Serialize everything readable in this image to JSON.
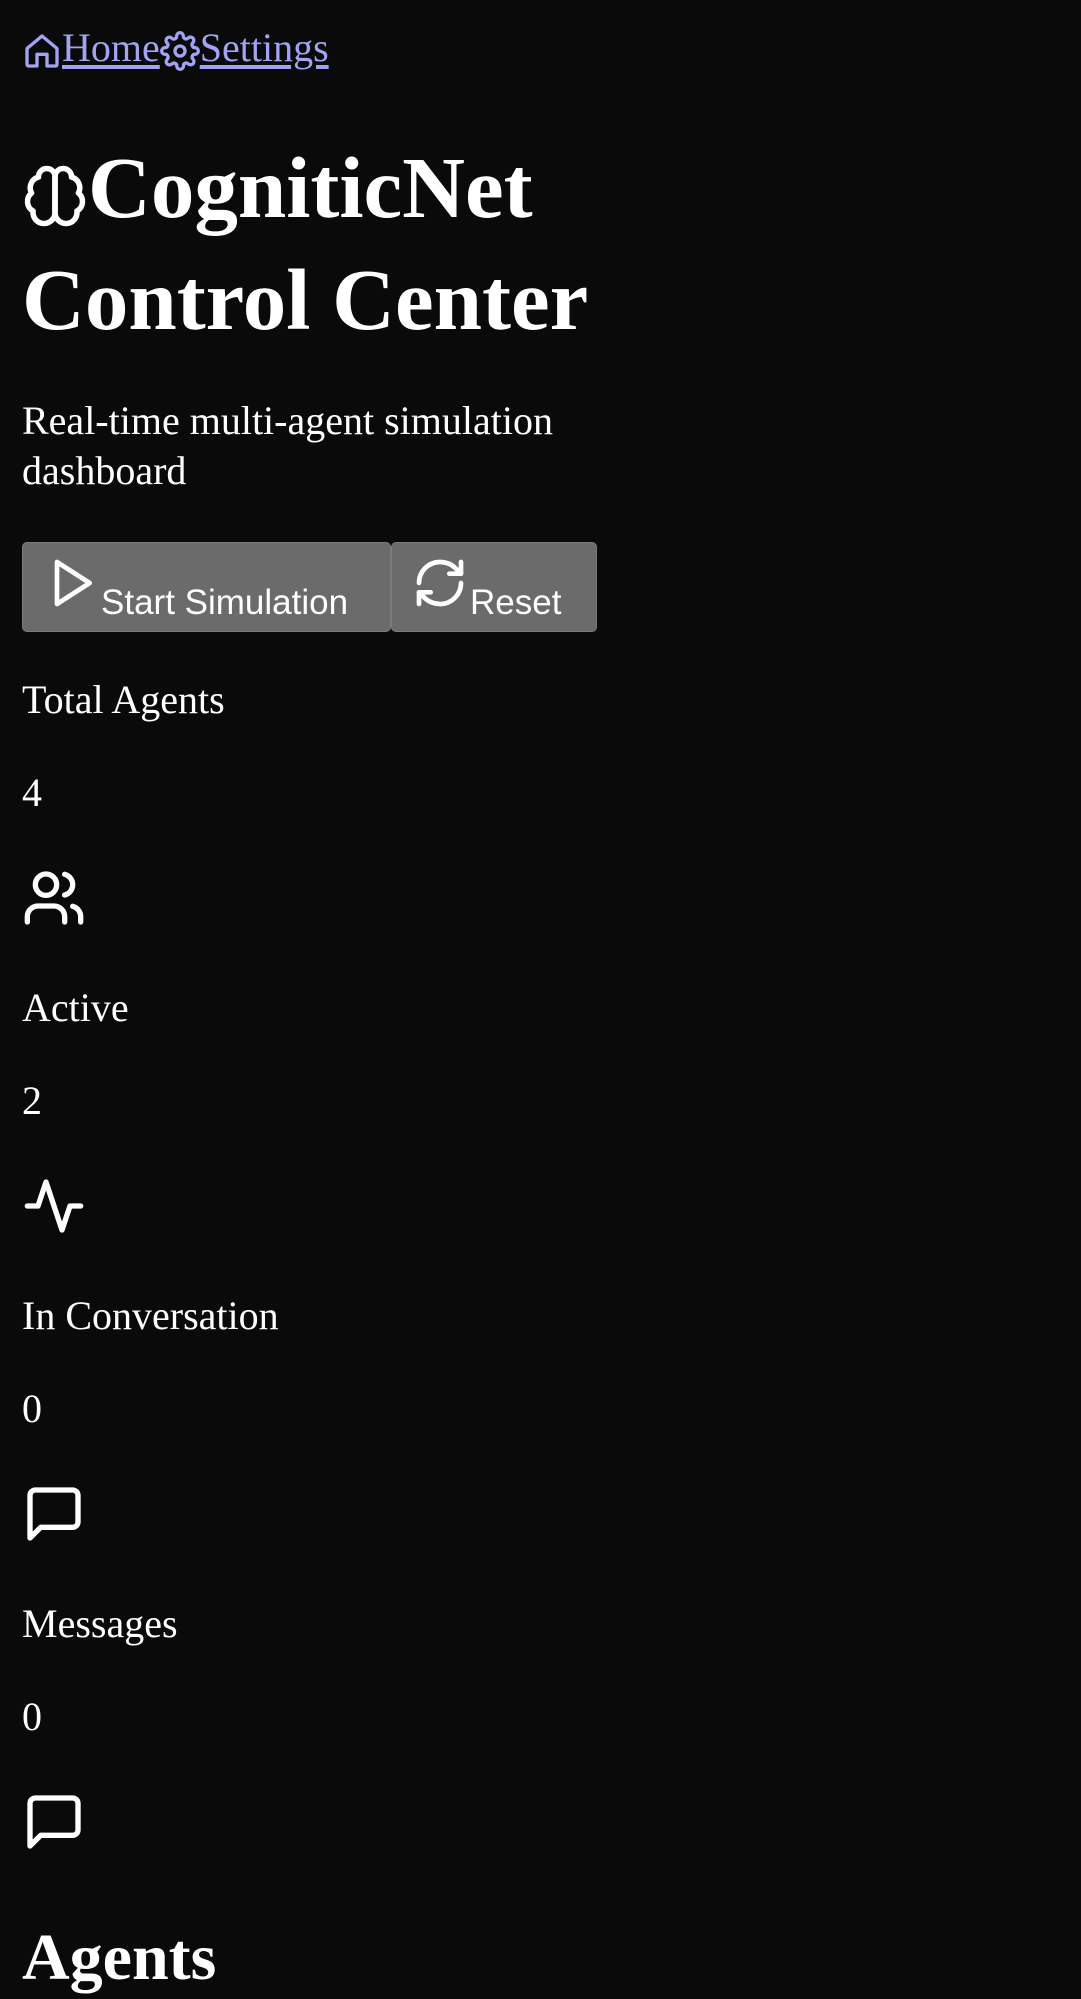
{
  "nav": {
    "home_label": "Home",
    "settings_label": "Settings"
  },
  "header": {
    "title_line1": "CogniticNet",
    "title_line2": "Control Center",
    "subtitle": "Real-time multi-agent simulation dashboard",
    "icon": "brain-icon"
  },
  "actions": {
    "start_label": "Start Simulation",
    "start_icon": "play-icon",
    "reset_label": "Reset",
    "reset_icon": "refresh-icon"
  },
  "stats": [
    {
      "label": "Total Agents",
      "value": "4",
      "icon": "users-icon"
    },
    {
      "label": "Active",
      "value": "2",
      "icon": "activity-icon"
    },
    {
      "label": "In Conversation",
      "value": "0",
      "icon": "message-square-icon"
    },
    {
      "label": "Messages",
      "value": "0",
      "icon": "message-square-icon"
    }
  ],
  "sections": {
    "agents_title": "Agents"
  },
  "colors": {
    "background": "#0a0a0a",
    "link": "#a3a3f5",
    "button": "#6b6b6b",
    "text": "#ffffff"
  }
}
